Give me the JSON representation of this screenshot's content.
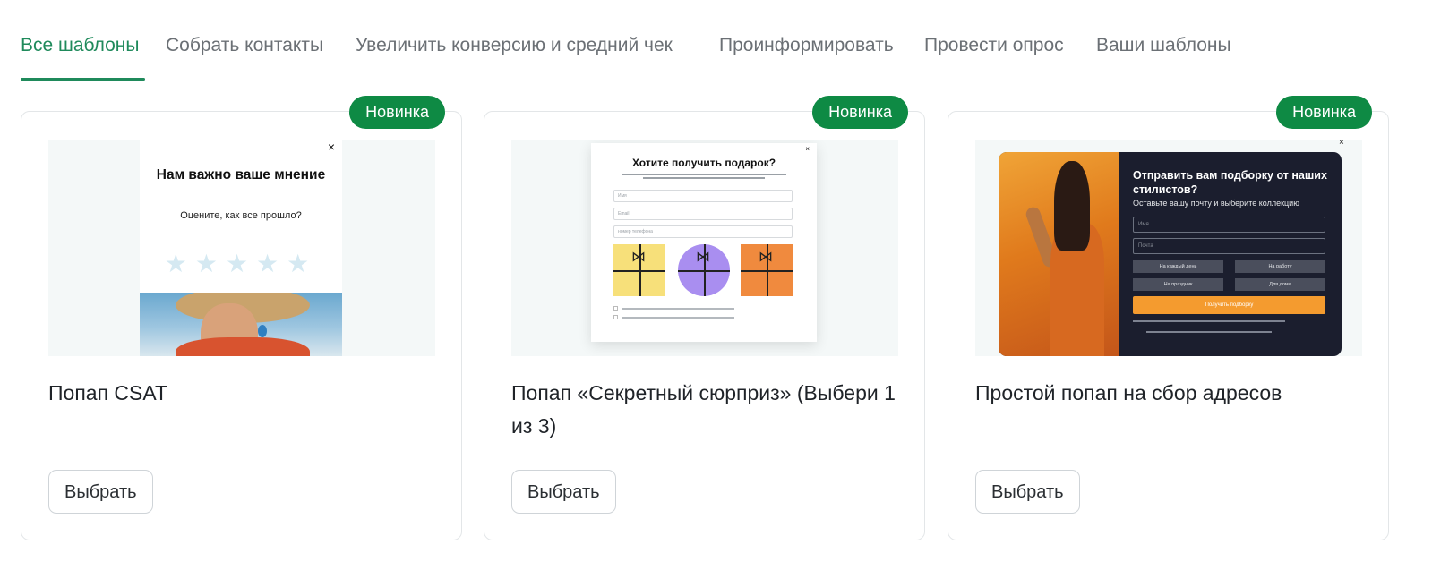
{
  "tabs": [
    {
      "label": "Все шаблоны",
      "active": true
    },
    {
      "label": "Собрать контакты",
      "active": false
    },
    {
      "label": "Увеличить конверсию и средний чек",
      "active": false
    },
    {
      "label": "Проинформировать",
      "active": false
    },
    {
      "label": "Провести опрос",
      "active": false
    },
    {
      "label": "Ваши шаблоны",
      "active": false
    }
  ],
  "colors": {
    "accent": "#1f8a5b",
    "badge": "#0e8a44"
  },
  "cards": [
    {
      "badge": "Новинка",
      "title": "Попап CSAT",
      "button": "Выбрать",
      "preview": {
        "close": "×",
        "heading": "Нам важно ваше мнение",
        "subheading": "Оцените, как все прошло?",
        "stars": "★★★★★",
        "rating_scale": 5
      }
    },
    {
      "badge": "Новинка",
      "title": "Попап «Секретный сюрприз» (Выбери 1 из 3)",
      "button": "Выбрать",
      "preview": {
        "close": "×",
        "heading": "Хотите получить подарок?",
        "fields": [
          "Имя",
          "Email",
          "номер телефона"
        ],
        "bow": "⋈"
      }
    },
    {
      "badge": "Новинка",
      "title": "Простой попап на сбор адресов",
      "button": "Выбрать",
      "preview": {
        "close": "×",
        "heading": "Отправить вам подборку от наших стилистов?",
        "subheading": "Оставьте вашу почту и выберите коллекцию",
        "inputs": [
          "Имя",
          "Почта"
        ],
        "options": [
          "На каждый день",
          "На работу",
          "На праздник",
          "Для дома"
        ],
        "cta": "Получить подборку"
      }
    }
  ]
}
